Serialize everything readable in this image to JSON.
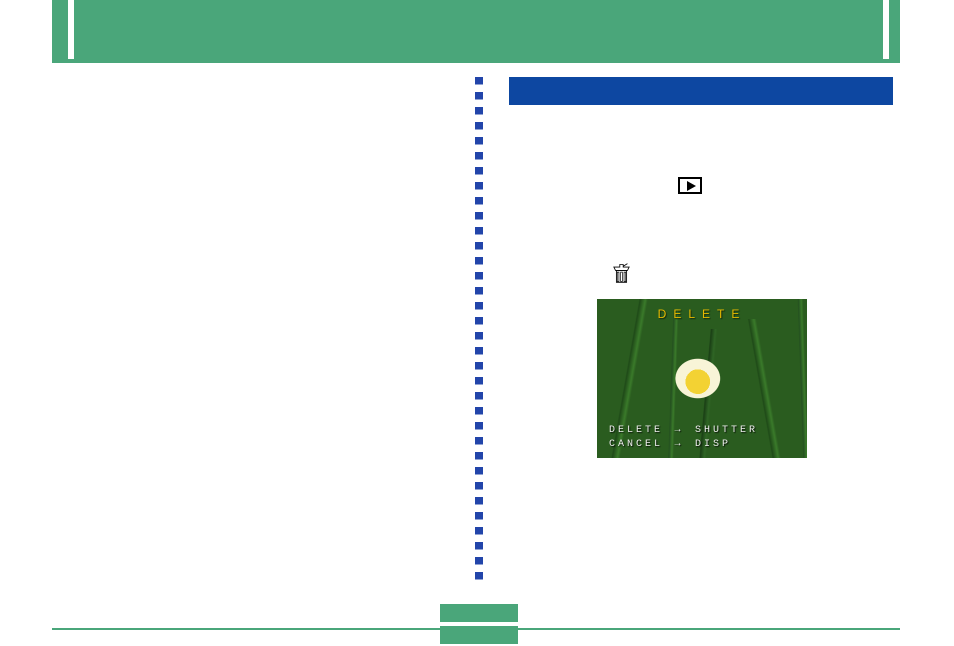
{
  "screen": {
    "title": "DELETE",
    "rows": [
      {
        "left": "DELETE",
        "right": "SHUTTER"
      },
      {
        "left": "CANCEL",
        "right": "DISP"
      }
    ]
  }
}
